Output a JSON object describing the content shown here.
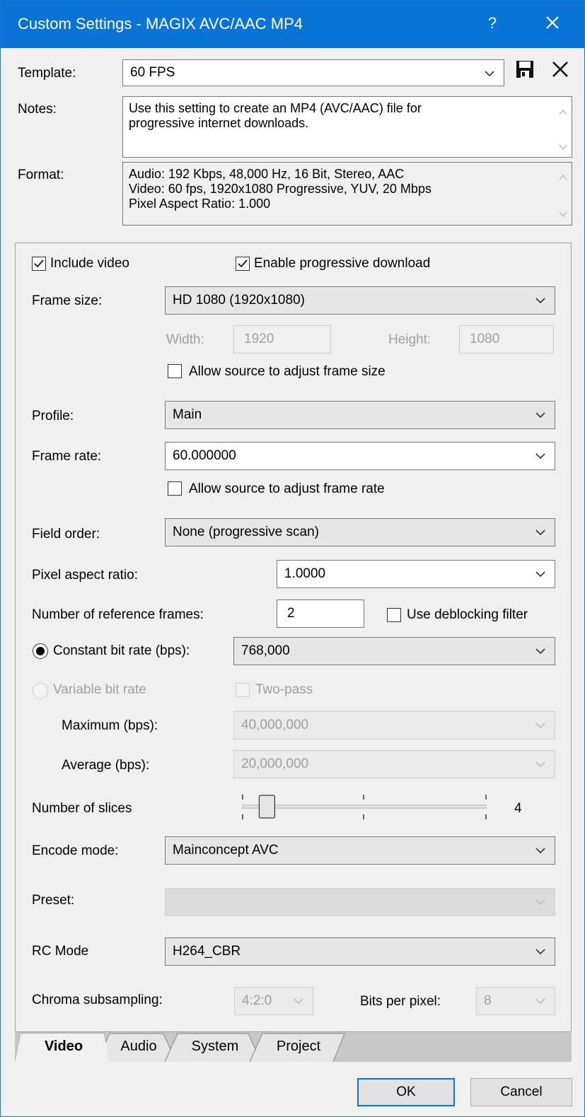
{
  "window": {
    "title": "Custom Settings - MAGIX AVC/AAC MP4",
    "help_label": "?"
  },
  "header": {
    "template_label": "Template:",
    "template_value": "60 FPS",
    "notes_label": "Notes:",
    "notes_text_line1": "Use this setting to create an MP4 (AVC/AAC) file for",
    "notes_text_line2": "progressive internet downloads.",
    "format_label": "Format:",
    "format_line1": "Audio: 192 Kbps, 48,000 Hz, 16 Bit, Stereo, AAC",
    "format_line2": "Video: 60 fps, 1920x1080 Progressive, YUV, 20 Mbps",
    "format_line3": "Pixel Aspect Ratio: 1.000"
  },
  "video": {
    "include_video_label": "Include video",
    "include_video_checked": true,
    "progressive_label": "Enable progressive download",
    "progressive_checked": true,
    "frame_size_label": "Frame size:",
    "frame_size_value": "HD 1080 (1920x1080)",
    "width_label": "Width:",
    "width_value": "1920",
    "height_label": "Height:",
    "height_value": "1080",
    "allow_frame_size_label": "Allow source to adjust frame size",
    "profile_label": "Profile:",
    "profile_value": "Main",
    "frame_rate_label": "Frame rate:",
    "frame_rate_value": "60.000000",
    "allow_frame_rate_label": "Allow source to adjust frame rate",
    "field_order_label": "Field order:",
    "field_order_value": "None (progressive scan)",
    "pixel_aspect_label": "Pixel aspect ratio:",
    "pixel_aspect_value": "1.0000",
    "ref_frames_label": "Number of reference frames:",
    "ref_frames_value": "2",
    "deblocking_label": "Use deblocking filter",
    "cbr_label": "Constant bit rate (bps):",
    "cbr_value": "768,000",
    "vbr_label": "Variable bit rate",
    "two_pass_label": "Two-pass",
    "maximum_label": "Maximum (bps):",
    "maximum_value": "40,000,000",
    "average_label": "Average (bps):",
    "average_value": "20,000,000",
    "slices_label": "Number of slices",
    "slices_value": "4",
    "slices_position_fraction": 0.1,
    "encode_mode_label": "Encode mode:",
    "encode_mode_value": "Mainconcept AVC",
    "preset_label": "Preset:",
    "preset_value": "",
    "rc_mode_label": "RC Mode",
    "rc_mode_value": "H264_CBR",
    "chroma_label": "Chroma subsampling:",
    "chroma_value": "4:2:0",
    "bpp_label": "Bits per pixel:",
    "bpp_value": "8"
  },
  "tabs": [
    {
      "label": "Video",
      "active": true
    },
    {
      "label": "Audio",
      "active": false
    },
    {
      "label": "System",
      "active": false
    },
    {
      "label": "Project",
      "active": false
    }
  ],
  "buttons": {
    "ok_label": "OK",
    "cancel_label": "Cancel"
  },
  "icons": {
    "save": "floppy-disk-icon",
    "delete": "x-icon",
    "dropdown": "chevron-down-icon"
  },
  "colors": {
    "titlebar": "#0a74d6",
    "focus_border": "#0078d7"
  }
}
